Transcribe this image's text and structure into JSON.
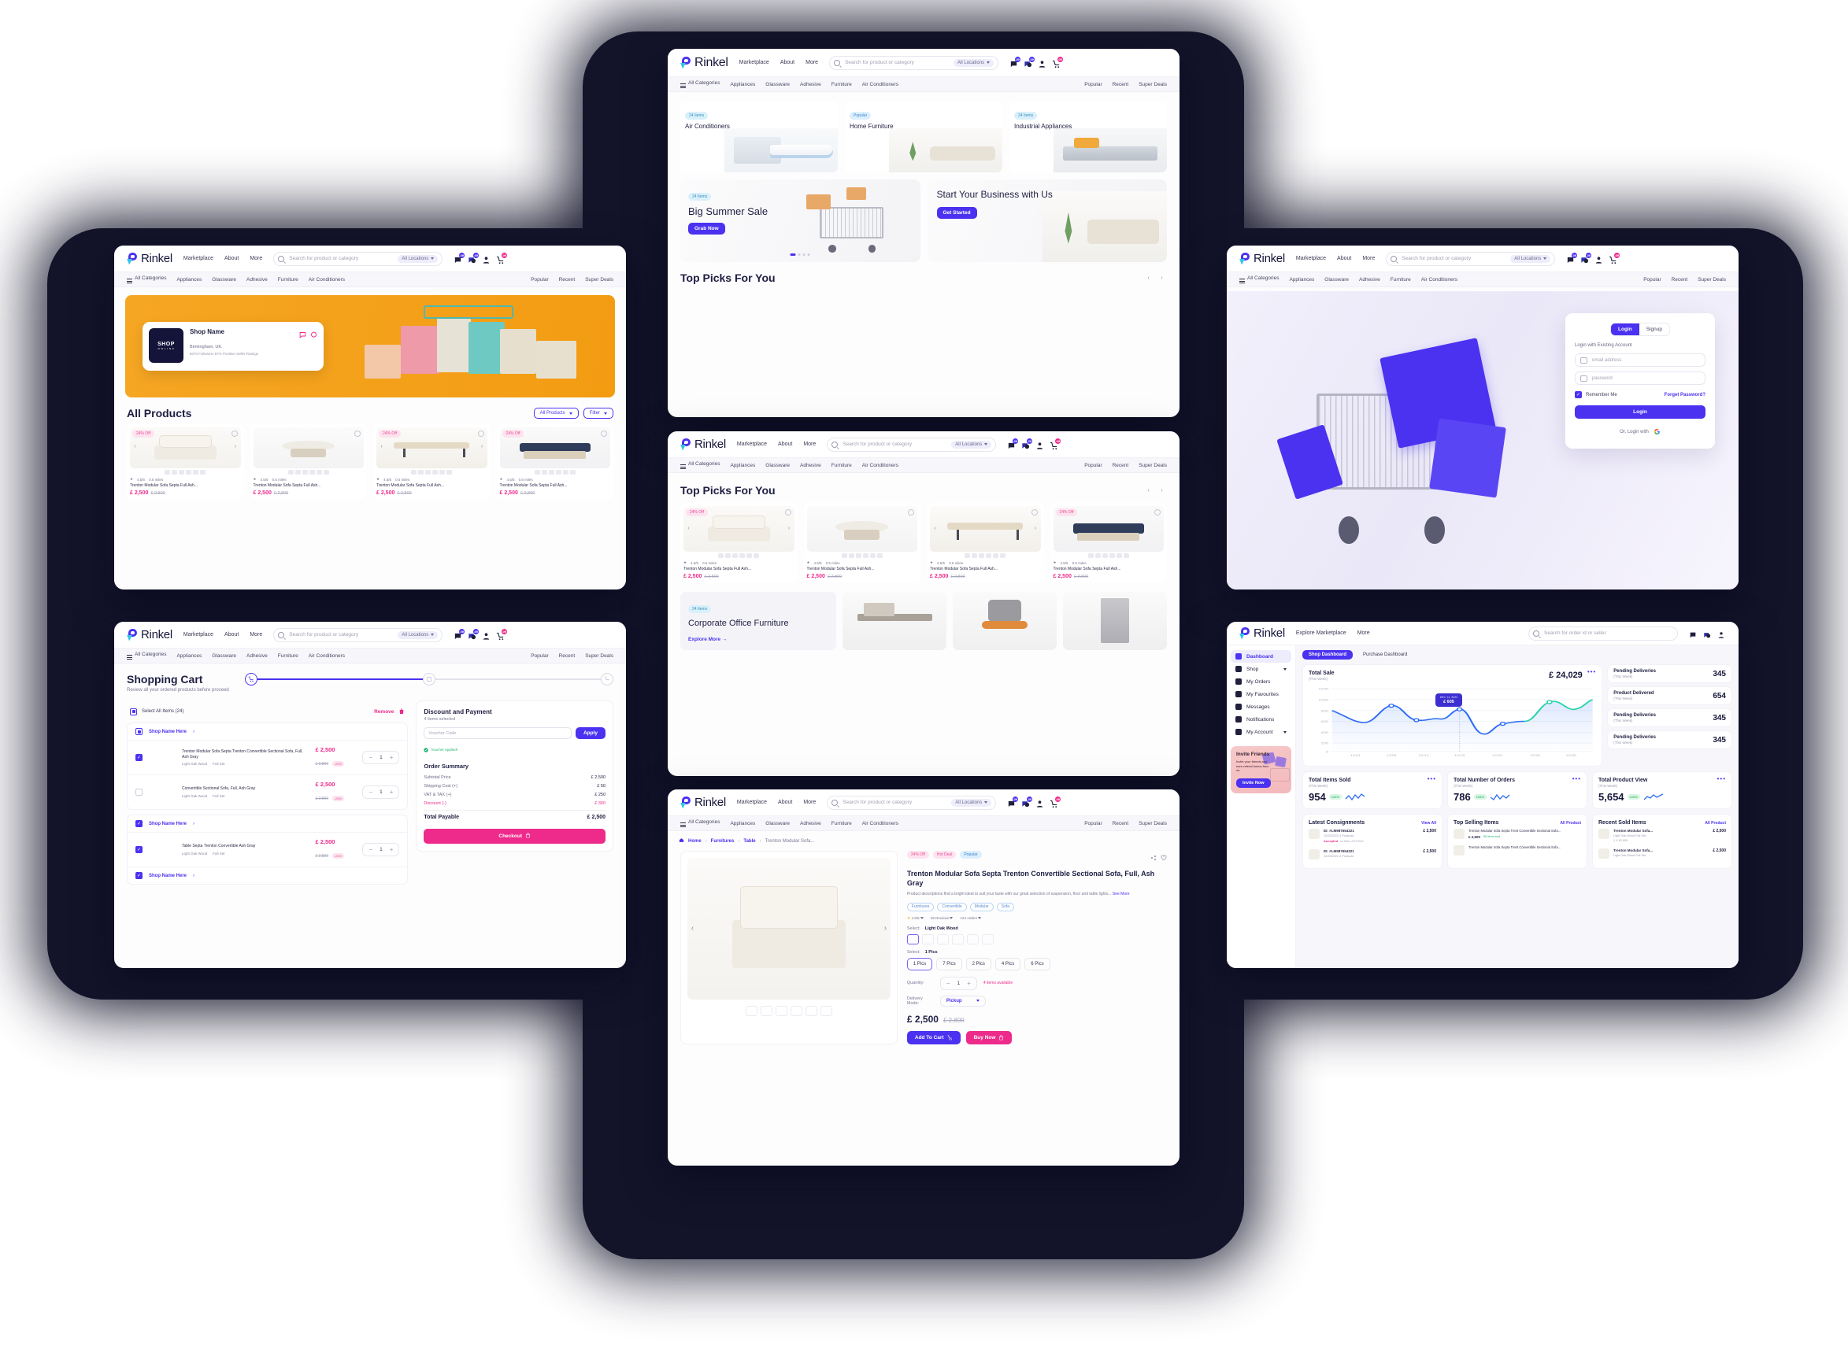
{
  "brand": {
    "name": "Rinkel",
    "accent": "#4a32f0",
    "pink": "#ee2a8a"
  },
  "nav": {
    "links": [
      "Marketplace",
      "About",
      "More"
    ],
    "search_placeholder": "Search for product or category",
    "location": "All Locations",
    "icons": [
      "chat-icon",
      "notification-icon",
      "user-icon",
      "cart-icon"
    ],
    "badges": {
      "chat": "09",
      "notification": "09",
      "cart": "09"
    }
  },
  "categories": {
    "all": "All Categories",
    "items": [
      "Appliances",
      "Glassware",
      "Adhesive",
      "Furniture",
      "Air Conditioners"
    ],
    "right": [
      "Popular",
      "Recent",
      "Super Deals"
    ]
  },
  "shop_panel": {
    "shop_name": "Shop Name",
    "location": "Birmingham, UK.",
    "stats": "6070 Followers   87% Positive Seller Ratings",
    "logo_text": "SHOP",
    "logo_sub": "O N L I N E",
    "section_title": "All Products",
    "filter_all": "All Products",
    "filter_label": "Filter",
    "products": [
      {
        "badge": "24% Off",
        "title": "Trenton Modular Sofa Septa Full Ash...",
        "price": "£ 2,500",
        "old": "£ 2,800",
        "rating": "4.5/5",
        "distance": "0.5 miles",
        "img": "sofa-cream"
      },
      {
        "badge": "",
        "title": "Trenton Modular Sofa Septa Full Ash...",
        "price": "£ 2,500",
        "old": "£ 2,800",
        "rating": "4.5/5",
        "distance": "0.5 miles",
        "img": "table-set"
      },
      {
        "badge": "24% Off",
        "title": "Trenton Modular Sofa Septa Full Ash...",
        "price": "£ 2,500",
        "old": "£ 2,800",
        "rating": "4.5/5",
        "distance": "0.5 miles",
        "img": "wood-table"
      },
      {
        "badge": "24% Off",
        "title": "Trenton Modular Sofa Septa Full Ash...",
        "price": "£ 2,500",
        "old": "£ 2,800",
        "rating": "4.5/5",
        "distance": "0.5 miles",
        "img": "navy-sofa"
      }
    ]
  },
  "cart_panel": {
    "title": "Shopping Cart",
    "subtitle": "Review all your ordered products before proceed",
    "select_all": "Select All Items (24)",
    "remove": "Remove",
    "shop_name": "Shop Name Here",
    "items": [
      {
        "title": "Trenton Modular Sofa Septa Trenton Convertible Sectional Sofa, Full, Ash Gray",
        "opt1": "Light Oak Wood",
        "opt2": "Full Set",
        "price": "£ 2,500",
        "old": "£ 2,800",
        "disc": "-24%",
        "qty": "1",
        "checked": true,
        "img": "sofa-cream"
      },
      {
        "title": "Convertible Sectional Sofa, Full, Ash Gray",
        "opt1": "Light Oak Wood",
        "opt2": "Full Set",
        "price": "£ 2,500",
        "old": "£ 2,800",
        "disc": "-24%",
        "qty": "1",
        "checked": false,
        "img": "navy-sofa"
      },
      {
        "title": "Table Septa Trenton Convertible Ash Gray",
        "opt1": "Light Oak Wood",
        "opt2": "Full Set",
        "price": "£ 2,500",
        "old": "£ 2,800",
        "disc": "-24%",
        "qty": "1",
        "checked": true,
        "img": "wood-table"
      }
    ],
    "payment": {
      "title": "Discount and Payment",
      "selected": "4 items selected",
      "voucher_placeholder": "Voucher Code",
      "apply": "Apply",
      "voucher_applied": "Voucher Applied!",
      "summary_title": "Order Summary",
      "rows": [
        {
          "label": "Subtotal Price",
          "value": "£ 2,500"
        },
        {
          "label": "Shipping Cost (+)",
          "value": "£ 50"
        },
        {
          "label": "VAT & TAX (+)",
          "value": "£ 250"
        },
        {
          "label": "Discount (-)",
          "value": "£ 300"
        }
      ],
      "total_label": "Total Payable",
      "total_value": "£ 2,500",
      "checkout": "Checkout"
    }
  },
  "home_panel": {
    "tiles": [
      {
        "chip": "24 Items",
        "title": "Air Conditioners",
        "img": "ac-img"
      },
      {
        "chip": "Popular",
        "title": "Home Furniture",
        "img": "home-furn"
      },
      {
        "chip": "24 Items",
        "title": "Industrial Appliances",
        "img": "indus"
      }
    ],
    "promo_left": {
      "chip": "24 Items",
      "title": "Big Summer Sale",
      "cta": "Grab Now"
    },
    "promo_right": {
      "title": "Start Your Business with Us",
      "cta": "Get Started"
    },
    "top_picks": "Top Picks For You"
  },
  "picks_panel": {
    "title": "Top Picks For You",
    "products": [
      {
        "badge": "24% Off",
        "title": "Trenton Modular Sofa Septa Full Ash...",
        "price": "£ 2,500",
        "old": "£ 2,800",
        "rating": "4.5/5",
        "distance": "0.5 miles",
        "img": "sofa-cream"
      },
      {
        "badge": "",
        "title": "Trenton Modular Sofa Septa Full Ash...",
        "price": "£ 2,500",
        "old": "£ 2,800",
        "rating": "4.5/5",
        "distance": "0.5 miles",
        "img": "table-set"
      },
      {
        "badge": "",
        "title": "Trenton Modular Sofa Septa Full Ash...",
        "price": "£ 2,500",
        "old": "£ 2,800",
        "rating": "4.5/5",
        "distance": "0.5 miles",
        "img": "wood-table"
      },
      {
        "badge": "24% Off",
        "title": "Trenton Modular Sofa Septa Full Ash...",
        "price": "£ 2,500",
        "old": "£ 2,800",
        "rating": "4.5/5",
        "distance": "0.5 miles",
        "img": "navy-sofa"
      }
    ],
    "corporate": {
      "chip": "24 Items",
      "title": "Corporate Office Furniture",
      "cta": "Explore More"
    },
    "corporate_imgs": [
      "office-desk",
      "office-chair",
      "cabinet"
    ]
  },
  "detail_panel": {
    "breadcrumb": [
      "Home",
      "Furnitures",
      "Table",
      "Trenton Modular Sofa..."
    ],
    "badges": [
      "24% Off",
      "Hot Deal",
      "Popular"
    ],
    "title": "Trenton Modular Sofa Septa Trenton Convertible Sectional Sofa, Full, Ash Gray",
    "description": "Product descriptions find a bright ideal to suit your taste with our great selection of suspension, floor and table lights...",
    "see_more": "See More",
    "tags": [
      "Furnitures",
      "Convertible",
      "Modular",
      "Sofa"
    ],
    "rating": "4.5/5",
    "reviews": "38 Reviews",
    "orders": "124 orders",
    "select_color_label": "Select:",
    "select_color_value": "Light Oak Wood",
    "select_pics_label": "Select:",
    "select_pics_value": "1 Pics",
    "pics_options": [
      "1 Pics",
      "7 Pics",
      "2 Pics",
      "4 Pics",
      "6 Pics"
    ],
    "quantity_label": "Quantity:",
    "quantity": "1",
    "availability": "4 items available",
    "delivery_label": "Delivery Mode:",
    "delivery_value": "Pickup",
    "price": "£ 2,500",
    "old_price": "£ 2,800",
    "add_to_cart": "Add To Cart",
    "buy_now": "Buy Now"
  },
  "login_panel": {
    "tab_login": "Login",
    "tab_signup": "Signup",
    "heading": "Login with Existing Account",
    "email_placeholder": "email address",
    "password_placeholder": "password",
    "remember": "Remember Me",
    "forgot": "Forget Password?",
    "login_button": "Login",
    "or_text": "Or, Login with"
  },
  "dashboard_panel": {
    "nav_links": [
      "Explore Marketplace",
      "More"
    ],
    "search_placeholder": "Search for order id or seller",
    "sidebar": [
      {
        "label": "Dashboard",
        "icon": "grid-icon",
        "active": true
      },
      {
        "label": "Shop",
        "icon": "store-icon",
        "caret": true
      },
      {
        "label": "My Orders",
        "icon": "bag-icon"
      },
      {
        "label": "My Favourites",
        "icon": "heart-icon"
      },
      {
        "label": "Messages",
        "icon": "message-icon"
      },
      {
        "label": "Notifications",
        "icon": "bell-icon"
      },
      {
        "label": "My Account",
        "icon": "user-icon",
        "caret": true
      }
    ],
    "tabs": [
      "Shop Dashboard",
      "Purchase Dashboard"
    ],
    "total_sale": {
      "title": "Total Sale",
      "sub": "(This Week)",
      "value": "£ 24,029"
    },
    "side_stats": [
      {
        "title": "Pending Deliveries",
        "sub": "(This Week)",
        "value": "345"
      },
      {
        "title": "Product Delivered",
        "sub": "(This Week)",
        "value": "654"
      },
      {
        "title": "Pending Deliveries",
        "sub": "(This Week)",
        "value": "345"
      },
      {
        "title": "Pending Deliveries",
        "sub": "(This Week)",
        "value": "345"
      }
    ],
    "kpis": [
      {
        "title": "Total Items Sold",
        "sub": "(This Week)",
        "value": "954",
        "delta": "125%"
      },
      {
        "title": "Total Number of Orders",
        "sub": "(This Week)",
        "value": "786",
        "delta": "125%"
      },
      {
        "title": "Total Product View",
        "sub": "(This Week)",
        "value": "5,654",
        "delta": "125%"
      }
    ],
    "lists": [
      {
        "title": "Latest Consignments",
        "action": "View All",
        "rows": [
          {
            "line1": "ID: #LM987654321",
            "line2": "12/23/2022   4 Products",
            "line3": "Accepted",
            "line4": "on Date 12/27/2022",
            "price": "£ 2,500"
          },
          {
            "line1": "ID: #LM987654321",
            "line2": "12/23/2022   4 Products",
            "line3": "",
            "line4": "",
            "price": "£ 2,500"
          }
        ]
      },
      {
        "title": "Top Selling Items",
        "action": "All Product",
        "rows": [
          {
            "line1": "Trenton Modular Sofa Septa Trent Convertible Sectional Sofa...",
            "line2": "£ 2,500",
            "line3": "88 items sold",
            "price": ""
          },
          {
            "line1": "Trenton Modular Sofa Septa Trent Convertible Sectional Sofa...",
            "line2": "",
            "line3": "",
            "price": ""
          }
        ]
      },
      {
        "title": "Recent Sold Items",
        "action": "All Product",
        "rows": [
          {
            "line1": "Trenton Modular Sofa...",
            "line2": "Light Oak Wood   Full Set",
            "line3": "1 X £2,500",
            "price": "£ 2,500"
          },
          {
            "line1": "Trenton Modular Sofa...",
            "line2": "Light Oak Wood   Full Set",
            "line3": "",
            "price": "£ 2,500"
          }
        ]
      }
    ],
    "invite": {
      "title": "Invite Friends",
      "text": "Invite your friends and earn referal bonus from us.",
      "cta": "Invite Now"
    },
    "chart_data": {
      "type": "line",
      "title": "Total Sale",
      "subtitle": "(This Week)",
      "ylabel": "",
      "xlabel": "",
      "ylim": [
        0,
        1200
      ],
      "yticks": [
        0,
        200,
        400,
        600,
        800,
        1000,
        1200
      ],
      "x": [
        "12/01",
        "12/05",
        "12/10",
        "12/15",
        "12/20",
        "12/25",
        "12/30"
      ],
      "values": [
        800,
        560,
        840,
        600,
        640,
        470,
        760,
        350,
        560,
        580,
        930,
        830,
        1000
      ],
      "tooltip": {
        "label": "DEC 14, 2022",
        "value": "£ 605"
      },
      "grid": true,
      "legend": "none",
      "colors": [
        "#2b6cf5",
        "#22d3a8"
      ]
    }
  }
}
